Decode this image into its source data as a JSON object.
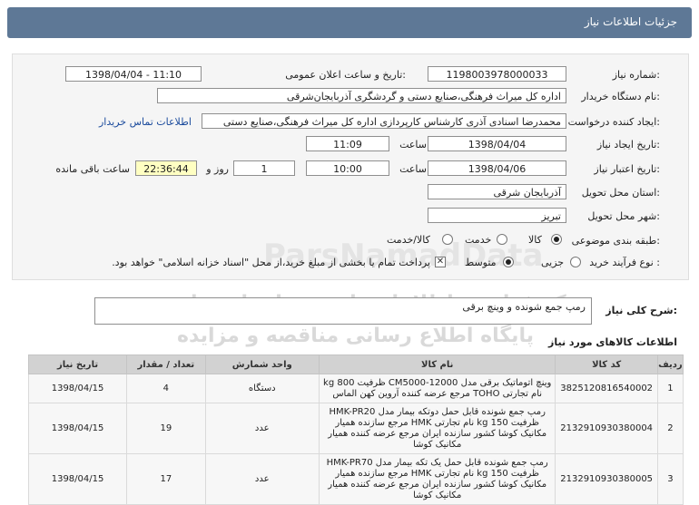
{
  "header": {
    "title": "جزئیات اطلاعات نیاز"
  },
  "form": {
    "need_number_label": "شماره نیاز:",
    "need_number": "1198003978000033",
    "announce_label": "تاریخ و ساعت اعلان عمومی:",
    "announce_value": "1398/04/04 - 11:10",
    "buyer_label": "نام دستگاه خریدار:",
    "buyer_value": "اداره کل میراث فرهنگی،صنایع دستی و گردشگری آذربایجان‌شرقی",
    "requester_label": "ایجاد کننده درخواست:",
    "requester_value": "محمدرضا اسنادی آذری کارشناس کارپردازی اداره کل میراث فرهنگی،صنایع دستی",
    "contact_link": "اطلاعات تماس خریدار",
    "create_date_label": "تاریخ ایجاد نیاز:",
    "create_date": "1398/04/04",
    "time_label": "ساعت",
    "create_time": "11:09",
    "valid_date_label": "تاریخ اعتبار نیاز:",
    "valid_date": "1398/04/06",
    "valid_time": "10:00",
    "days_value": "1",
    "days_label": "روز و",
    "remaining_value": "22:36:44",
    "remaining_label": "ساعت باقی مانده",
    "province_label": "استان محل تحویل:",
    "province_value": "آذربایجان شرقی",
    "city_label": "شهر محل تحویل:",
    "city_value": "تبریز",
    "category_label": "طبقه بندی موضوعی:",
    "category_options": [
      "کالا",
      "خدمت",
      "کالا/خدمت"
    ],
    "process_label": "نوع فرآیند خرید :",
    "process_options": [
      "جزیی",
      "متوسط"
    ],
    "payment_note": "پرداخت تمام یا بخشی از مبلغ خرید،از محل \"اسناد خزانه اسلامی\" خواهد بود."
  },
  "description": {
    "label": "شرح کلی نیاز:",
    "value": "رمپ جمع شونده و وینچ برقی"
  },
  "goods": {
    "title": "اطلاعات کالاهای مورد نیاز",
    "columns": [
      "ردیف",
      "کد کالا",
      "نام کالا",
      "واحد شمارش",
      "تعداد / مقدار",
      "تاریخ نیاز"
    ],
    "rows": [
      {
        "idx": "1",
        "code": "3825120816540002",
        "name": "وینچ اتوماتیک برقی مدل CM5000-12000 ظرفیت 800 kg نام تجارتی TOHO مرجع عرضه کننده آروین کهن الماس",
        "unit": "دستگاه",
        "qty": "4",
        "date": "1398/04/15"
      },
      {
        "idx": "2",
        "code": "2132910930380004",
        "name": "رمپ جمع شونده قابل حمل دوتکه بیمار مدل HMK-PR20 ظرفیت 150 kg نام تجارتی HMK مرجع سازنده همیار مکانیک کوشا کشور سازنده ایران مرجع عرضه کننده همیار مکانیک کوشا",
        "unit": "عدد",
        "qty": "19",
        "date": "1398/04/15"
      },
      {
        "idx": "3",
        "code": "2132910930380005",
        "name": "رمپ جمع شونده قابل حمل یک تکه بیمار مدل HMK-PR70 ظرفیت 150 kg نام تجارتی HMK مرجع سازنده همیار مکانیک کوشا کشور سازنده ایران مرجع عرضه کننده همیار مکانیک کوشا",
        "unit": "عدد",
        "qty": "17",
        "date": "1398/04/15"
      }
    ]
  },
  "watermark": {
    "line1": "ParsNamadData",
    "line2": "مرکز فراوری اطلاعات پارس نماد داده ها",
    "line3": "پایگاه اطلاع رسانی مناقصه و مزایده"
  },
  "colors": {
    "header": "#5e7896",
    "panel": "#f5f5f5",
    "link": "#1a4a9c",
    "remaining_bg": "#ffffc2"
  }
}
